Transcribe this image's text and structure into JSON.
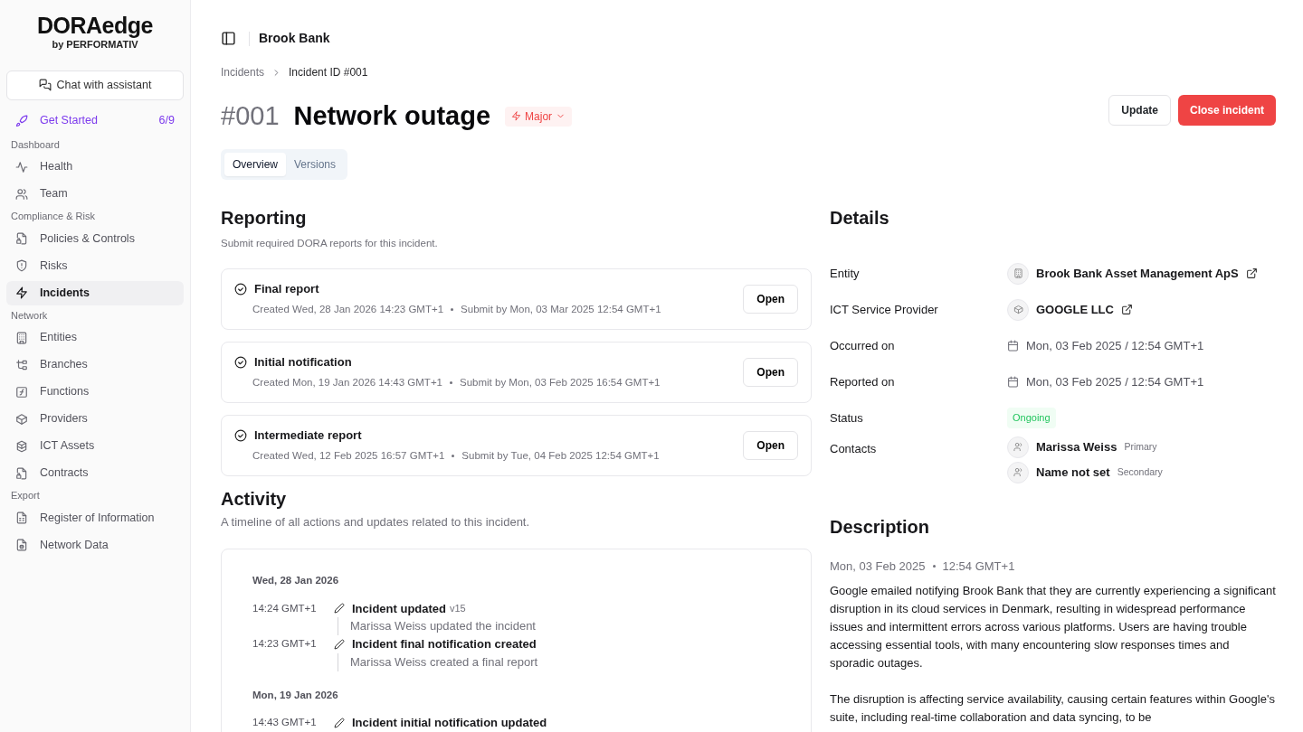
{
  "logo": {
    "name": "DORAedge",
    "byline": "by PERFORMATIV"
  },
  "chat_button": "Chat with assistant",
  "get_started": {
    "label": "Get Started",
    "progress": "6/9"
  },
  "sidebar": {
    "sections": [
      {
        "title": "Dashboard",
        "items": [
          {
            "label": "Health",
            "selected": false
          },
          {
            "label": "Team",
            "selected": false
          }
        ]
      },
      {
        "title": "Compliance & Risk",
        "items": [
          {
            "label": "Policies & Controls",
            "selected": false
          },
          {
            "label": "Risks",
            "selected": false
          },
          {
            "label": "Incidents",
            "selected": true
          }
        ]
      },
      {
        "title": "Network",
        "items": [
          {
            "label": "Entities",
            "selected": false
          },
          {
            "label": "Branches",
            "selected": false
          },
          {
            "label": "Functions",
            "selected": false
          },
          {
            "label": "Providers",
            "selected": false
          },
          {
            "label": "ICT Assets",
            "selected": false
          },
          {
            "label": "Contracts",
            "selected": false
          }
        ]
      },
      {
        "title": "Export",
        "items": [
          {
            "label": "Register of Information",
            "selected": false
          },
          {
            "label": "Network Data",
            "selected": false
          }
        ]
      }
    ]
  },
  "header": {
    "org": "Brook Bank"
  },
  "breadcrumb": [
    "Incidents",
    "Incident ID #001"
  ],
  "incident": {
    "number": "#001",
    "title": "Network outage",
    "severity": "Major"
  },
  "actions": [
    {
      "label": "Update",
      "kind": "secondary"
    },
    {
      "label": "Close incident",
      "kind": "danger"
    }
  ],
  "tabs": [
    {
      "label": "Overview",
      "selected": true
    },
    {
      "label": "Versions",
      "selected": false
    }
  ],
  "reporting": {
    "title": "Reporting",
    "subtitle": "Submit required DORA reports for this incident.",
    "reports": [
      {
        "title": "Final report",
        "created": "Created Wed, 28 Jan 2026 14:23 GMT+1",
        "submit_by": "Submit by Mon, 03 Mar 2025 12:54 GMT+1",
        "action": "Open"
      },
      {
        "title": "Initial notification",
        "created": "Created Mon, 19 Jan 2026 14:43 GMT+1",
        "submit_by": "Submit by Mon, 03 Feb 2025 16:54 GMT+1",
        "action": "Open"
      },
      {
        "title": "Intermediate report",
        "created": "Created Wed, 12 Feb 2025 16:57 GMT+1",
        "submit_by": "Submit by Tue, 04 Feb 2025 12:54 GMT+1",
        "action": "Open"
      }
    ]
  },
  "activity": {
    "title": "Activity",
    "subtitle": "A timeline of all actions and updates related to this incident.",
    "days": [
      {
        "date": "Wed, 28 Jan 2026",
        "events": [
          {
            "time": "14:24 GMT+1",
            "title": "Incident updated",
            "version": "v15",
            "detail": "Marissa Weiss updated the incident"
          },
          {
            "time": "14:23 GMT+1",
            "title": "Incident final notification created",
            "detail": "Marissa Weiss created a final report"
          }
        ]
      },
      {
        "date": "Mon, 19 Jan 2026",
        "events": [
          {
            "time": "14:43 GMT+1",
            "title": "Incident initial notification updated"
          }
        ]
      }
    ]
  },
  "details": {
    "title": "Details",
    "rows": [
      {
        "kind": "entity",
        "label": "Entity",
        "value": "Brook Bank Asset Management ApS"
      },
      {
        "kind": "provider",
        "label": "ICT Service Provider",
        "value": "GOOGLE LLC"
      },
      {
        "kind": "date",
        "label": "Occurred on",
        "value": "Mon, 03 Feb 2025 / 12:54 GMT+1"
      },
      {
        "kind": "date",
        "label": "Reported on",
        "value": "Mon, 03 Feb 2025 / 12:54 GMT+1"
      },
      {
        "kind": "status",
        "label": "Status",
        "value": "Ongoing"
      },
      {
        "kind": "contacts",
        "label": "Contacts",
        "contacts": [
          {
            "name": "Marissa Weiss",
            "role": "Primary"
          },
          {
            "name": "Name not set",
            "role": "Secondary"
          }
        ]
      }
    ]
  },
  "description": {
    "title": "Description",
    "date": "Mon, 03 Feb 2025",
    "time": "12:54 GMT+1",
    "paragraphs": [
      "Google emailed notifying Brook Bank that they are currently experiencing a significant disruption in its cloud services in Denmark, resulting in widespread performance issues and intermittent errors across various platforms. Users are having trouble accessing essential tools, with many encountering slow responses times and sporadic outages.",
      "The disruption is affecting service availability, causing certain features within Google's suite, including real-time collaboration and data syncing, to be"
    ]
  }
}
